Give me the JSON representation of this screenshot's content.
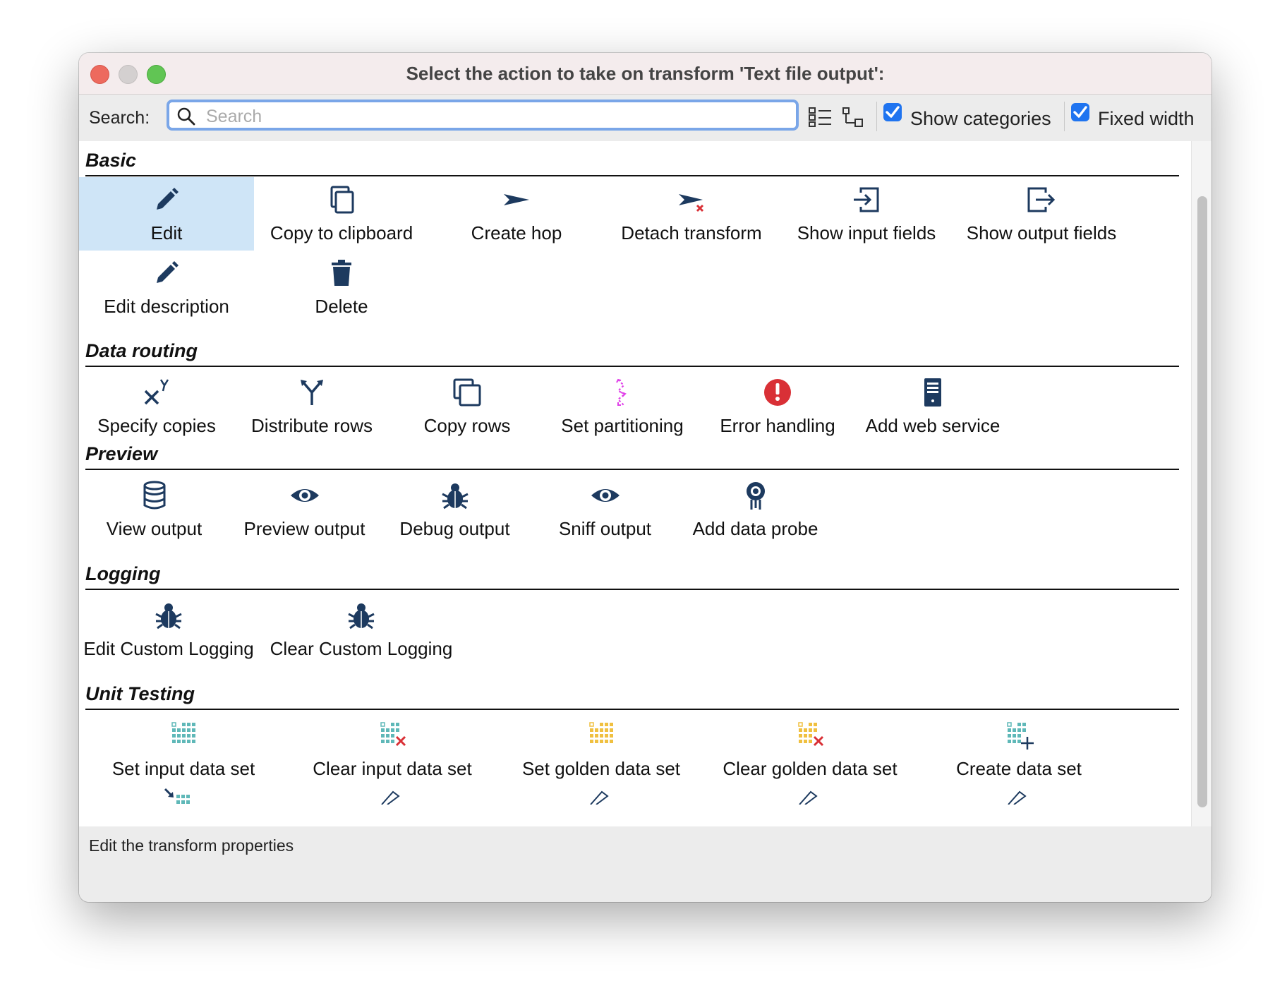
{
  "window": {
    "title": "Select the action to take on transform 'Text file output':"
  },
  "toolbar": {
    "search_label": "Search:",
    "search_placeholder": "Search",
    "search_value": "",
    "show_categories_label": "Show categories",
    "show_categories_checked": true,
    "fixed_width_label": "Fixed width",
    "fixed_width_checked": true
  },
  "categories": [
    {
      "name": "Basic",
      "items": [
        {
          "label": "Edit",
          "icon": "pencil-icon",
          "selected": true
        },
        {
          "label": "Copy to clipboard",
          "icon": "copy-icon"
        },
        {
          "label": "Create hop",
          "icon": "hop-arrow-icon"
        },
        {
          "label": "Detach transform",
          "icon": "detach-arrow-icon"
        },
        {
          "label": "Show input fields",
          "icon": "input-fields-icon"
        },
        {
          "label": "Show output fields",
          "icon": "output-fields-icon"
        },
        {
          "label": "Edit description",
          "icon": "pencil-icon"
        },
        {
          "label": "Delete",
          "icon": "trash-icon"
        }
      ]
    },
    {
      "name": "Data routing",
      "items": [
        {
          "label": "Specify copies",
          "icon": "copies-xy-icon"
        },
        {
          "label": "Distribute rows",
          "icon": "distribute-icon"
        },
        {
          "label": "Copy rows",
          "icon": "copy-rows-icon"
        },
        {
          "label": "Set partitioning",
          "icon": "partition-icon"
        },
        {
          "label": "Error handling",
          "icon": "error-icon"
        },
        {
          "label": "Add web service",
          "icon": "web-service-icon"
        }
      ]
    },
    {
      "name": "Preview",
      "items": [
        {
          "label": "View output",
          "icon": "database-icon"
        },
        {
          "label": "Preview output",
          "icon": "eye-icon"
        },
        {
          "label": "Debug output",
          "icon": "bug-icon"
        },
        {
          "label": "Sniff output",
          "icon": "eye-icon"
        },
        {
          "label": "Add data probe",
          "icon": "probe-icon"
        }
      ]
    },
    {
      "name": "Logging",
      "items": [
        {
          "label": "Edit Custom Logging",
          "icon": "bug-icon"
        },
        {
          "label": "Clear Custom Logging",
          "icon": "bug-icon"
        }
      ]
    },
    {
      "name": "Unit Testing",
      "items": [
        {
          "label": "Set input data set",
          "icon": "dataset-teal-icon"
        },
        {
          "label": "Clear input data set",
          "icon": "dataset-teal-clear-icon"
        },
        {
          "label": "Set golden data set",
          "icon": "dataset-gold-icon"
        },
        {
          "label": "Clear golden data set",
          "icon": "dataset-gold-clear-icon"
        },
        {
          "label": "Create data set",
          "icon": "dataset-create-icon"
        }
      ]
    }
  ],
  "status": {
    "text": "Edit the transform properties"
  },
  "colors": {
    "icon_navy": "#1d3a5f",
    "selected_bg": "#cfe5f7",
    "error_red": "#d93036",
    "partition_magenta": "#e040e8",
    "dataset_teal": "#5fb8b8",
    "dataset_gold": "#f0c040"
  }
}
